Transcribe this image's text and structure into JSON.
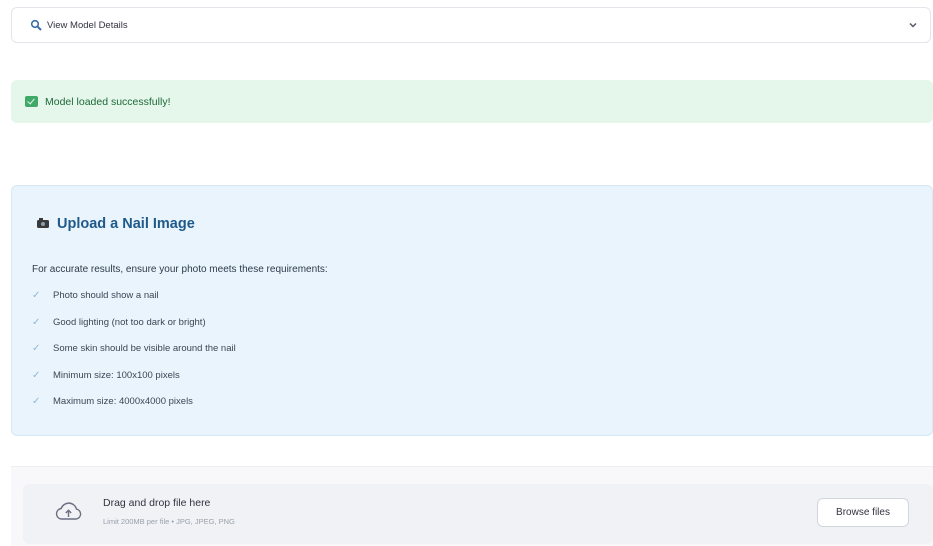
{
  "expander": {
    "label": "View Model Details",
    "icon": "magnifier-icon",
    "toggle_icon": "chevron-down-icon"
  },
  "success_alert": {
    "icon": "check-box-icon",
    "message": "Model loaded successfully!"
  },
  "upload_info": {
    "icon": "camera-icon",
    "title": "Upload a Nail Image",
    "intro": "For accurate results, ensure your photo meets these requirements:",
    "requirements": [
      {
        "check": "✓",
        "text": "Photo should show a nail"
      },
      {
        "check": "✓",
        "text": "Good lighting (not too dark or bright)"
      },
      {
        "check": "✓",
        "text": "Some skin should be visible around the nail"
      },
      {
        "check": "✓",
        "text": "Minimum size: 100x100 pixels"
      },
      {
        "check": "✓",
        "text": "Maximum size: 4000x4000 pixels"
      }
    ]
  },
  "uploader": {
    "icon": "cloud-upload-icon",
    "drop_text": "Drag and drop file here",
    "limit_text": "Limit 200MB per file • JPG, JPEG, PNG",
    "browse_label": "Browse files"
  },
  "colors": {
    "success_bg": "#e5f6ea",
    "info_bg": "#e9f4fc",
    "title_blue": "#1f5a8a"
  }
}
